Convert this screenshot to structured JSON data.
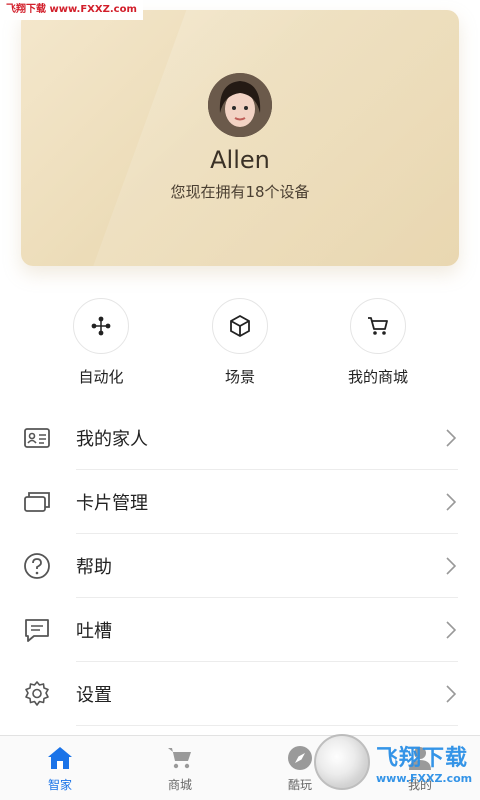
{
  "watermark_top": "飞翔下载 www.FXXZ.com",
  "profile": {
    "username": "Allen",
    "device_count_text": "您现在拥有18个设备"
  },
  "shortcuts": [
    {
      "label": "自动化",
      "icon": "automation-icon"
    },
    {
      "label": "场景",
      "icon": "cube-icon"
    },
    {
      "label": "我的商城",
      "icon": "cart-icon"
    }
  ],
  "menu": [
    {
      "label": "我的家人",
      "icon": "id-card-icon"
    },
    {
      "label": "卡片管理",
      "icon": "cards-icon"
    },
    {
      "label": "帮助",
      "icon": "question-icon"
    },
    {
      "label": "吐槽",
      "icon": "feedback-icon"
    },
    {
      "label": "设置",
      "icon": "gear-icon"
    }
  ],
  "tabs": [
    {
      "label": "智家",
      "icon": "home-icon",
      "active": true
    },
    {
      "label": "商城",
      "icon": "cart-icon",
      "active": false
    },
    {
      "label": "酷玩",
      "icon": "compass-icon",
      "active": false
    },
    {
      "label": "我的",
      "icon": "person-icon",
      "active": false
    }
  ],
  "logo_watermark": {
    "big": "飞翔下载",
    "small": "www.FXXZ.com"
  },
  "colors": {
    "accent": "#1a73e8",
    "card_bg": "#ecdcb8"
  }
}
